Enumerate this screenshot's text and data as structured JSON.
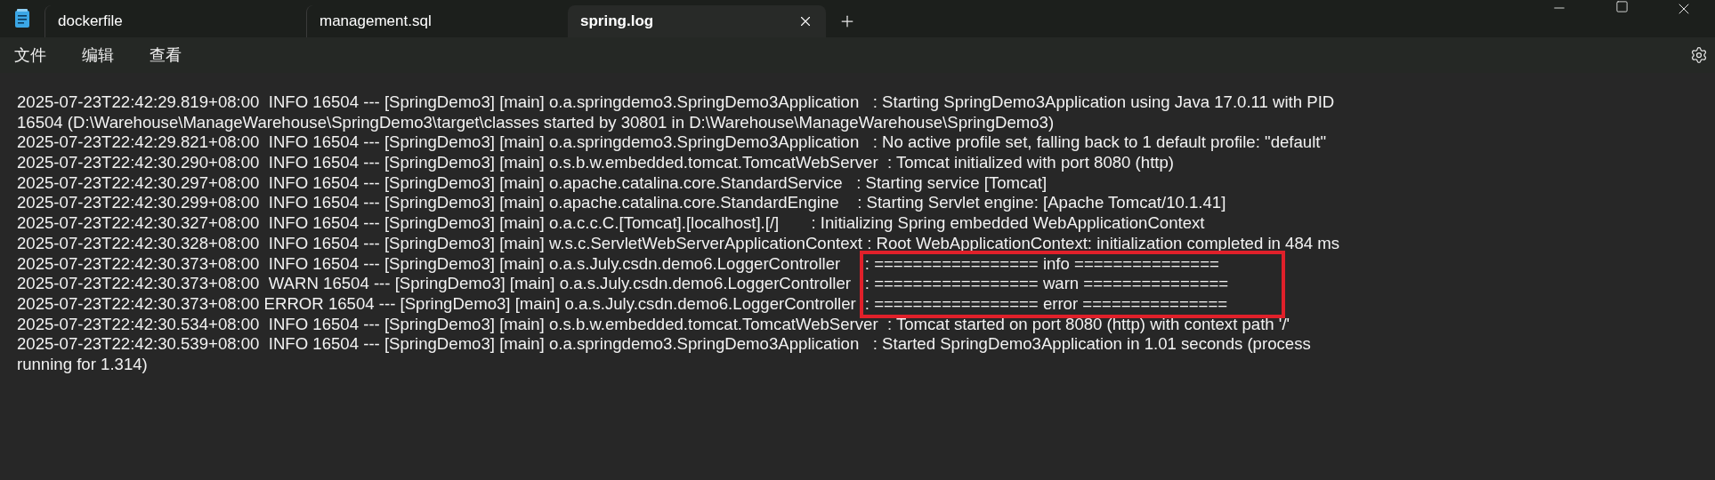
{
  "tabs": [
    {
      "label": "dockerfile",
      "selected": false
    },
    {
      "label": "management.sql",
      "selected": false
    },
    {
      "label": "spring.log",
      "selected": true
    }
  ],
  "menu": [
    "文件",
    "编辑",
    "查看"
  ],
  "lines": [
    {
      "kind": "plain",
      "text": "2025-07-23T22:42:29.819+08:00  INFO 16504 --- [SpringDemo3] [main] o.a.springdemo3.SpringDemo3Application   : Starting SpringDemo3Application using Java 17.0.11 with PID"
    },
    {
      "kind": "plain",
      "text": "16504 (D:\\Warehouse\\ManageWarehouse\\SpringDemo3\\target\\classes started by 30801 in D:\\Warehouse\\ManageWarehouse\\SpringDemo3)"
    },
    {
      "kind": "plain",
      "text": "2025-07-23T22:42:29.821+08:00  INFO 16504 --- [SpringDemo3] [main] o.a.springdemo3.SpringDemo3Application   : No active profile set, falling back to 1 default profile: \"default\""
    },
    {
      "kind": "plain",
      "text": "2025-07-23T22:42:30.290+08:00  INFO 16504 --- [SpringDemo3] [main] o.s.b.w.embedded.tomcat.TomcatWebServer  : Tomcat initialized with port 8080 (http)"
    },
    {
      "kind": "plain",
      "text": "2025-07-23T22:42:30.297+08:00  INFO 16504 --- [SpringDemo3] [main] o.apache.catalina.core.StandardService   : Starting service [Tomcat]"
    },
    {
      "kind": "plain",
      "text": "2025-07-23T22:42:30.299+08:00  INFO 16504 --- [SpringDemo3] [main] o.apache.catalina.core.StandardEngine    : Starting Servlet engine: [Apache Tomcat/10.1.41]"
    },
    {
      "kind": "plain",
      "text": "2025-07-23T22:42:30.327+08:00  INFO 16504 --- [SpringDemo3] [main] o.a.c.c.C.[Tomcat].[localhost].[/]       : Initializing Spring embedded WebApplicationContext"
    },
    {
      "kind": "plain",
      "text": "2025-07-23T22:42:30.328+08:00  INFO 16504 --- [SpringDemo3] [main] w.s.c.ServletWebServerApplicationContext : Root WebApplicationContext: initialization completed in 484 ms"
    },
    {
      "kind": "marked",
      "head": "2025-07-23T22:42:30.373+08:00  INFO 16504 --- [SpringDemo3] [main] o.a.s.July.csdn.demo6.LoggerController",
      "message": ": ================= info ==============="
    },
    {
      "kind": "marked",
      "head": "2025-07-23T22:42:30.373+08:00  WARN 16504 --- [SpringDemo3] [main] o.a.s.July.csdn.demo6.LoggerController",
      "message": ": ================= warn ==============="
    },
    {
      "kind": "marked",
      "head": "2025-07-23T22:42:30.373+08:00 ERROR 16504 --- [SpringDemo3] [main] o.a.s.July.csdn.demo6.LoggerController",
      "message": ": ================= error ==============="
    },
    {
      "kind": "plain",
      "text": "2025-07-23T22:42:30.534+08:00  INFO 16504 --- [SpringDemo3] [main] o.s.b.w.embedded.tomcat.TomcatWebServer  : Tomcat started on port 8080 (http) with context path '/'"
    },
    {
      "kind": "plain",
      "text": "2025-07-23T22:42:30.539+08:00  INFO 16504 --- [SpringDemo3] [main] o.a.springdemo3.SpringDemo3Application   : Started SpringDemo3Application in 1.01 seconds (process"
    },
    {
      "kind": "plain",
      "text": "running for 1.314)"
    }
  ]
}
